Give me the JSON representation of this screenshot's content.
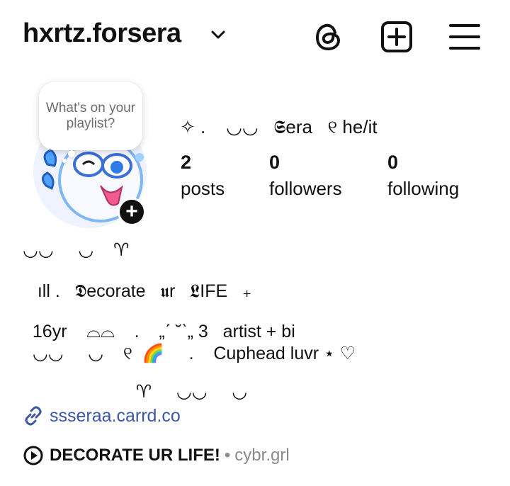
{
  "header": {
    "username": "hxrtz.forsera",
    "icons": [
      "threads-icon",
      "create-icon",
      "menu-icon"
    ]
  },
  "note": {
    "text": "What's on your playlist?"
  },
  "profile": {
    "display_name": "✧ .    ◡◡   𝕾era   ୧ he/it",
    "stats": [
      {
        "value": "2",
        "label": "posts"
      },
      {
        "value": "0",
        "label": "followers"
      },
      {
        "value": "0",
        "label": "following"
      }
    ]
  },
  "bio": {
    "line1": "◡◡     ◡    ♈︎",
    "line2": "   ıll .   𝕯ecorate   𝖚r   𝕷IFE   ₊",
    "line3": "  16yr    ⌓⌓    .    „ˊ ˘ˋ„ 3   artist + bi",
    "line4": "  ◡◡     ◡    ୧  🌈     .    Cuphead luvr ⋆ ♡",
    "line5": "                       ♈︎     ◡◡     ◡"
  },
  "link": {
    "text": "ssseraa.carrd.co"
  },
  "music": {
    "title": "DECORATE UR LIFE!",
    "separator": "•",
    "artist": "cybr.grl"
  },
  "colors": {
    "link": "#3b57a6",
    "muted": "#8a8a8a",
    "text": "#111111"
  }
}
